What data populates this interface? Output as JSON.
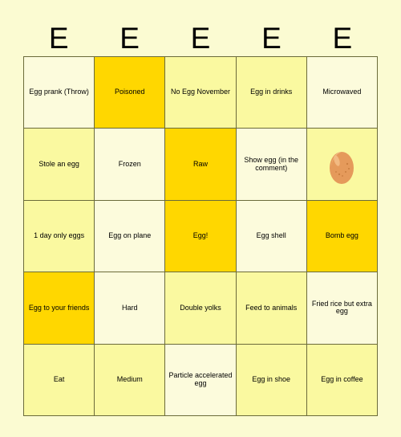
{
  "header": {
    "letters": [
      "E",
      "E",
      "E",
      "E",
      "E"
    ]
  },
  "colors": {
    "page_background": "#fbfbd2",
    "marked_gold": "#ffd700",
    "cell_yellow": "#faf9a0",
    "cell_cream": "#fcfbdc",
    "border": "#6b6b3a",
    "text": "#000000",
    "egg_body": "#e59a5b",
    "egg_highlight": "#f5c08a",
    "egg_speckle": "#c87c3e"
  },
  "grid": {
    "rows": 5,
    "columns": 5,
    "cells": [
      {
        "text": "Egg prank (Throw)",
        "bg": "cream",
        "size": "md"
      },
      {
        "text": "Poisoned",
        "bg": "gold",
        "size": "sm"
      },
      {
        "text": "No Egg November",
        "bg": "yellow",
        "size": "xs"
      },
      {
        "text": "Egg in drinks",
        "bg": "yellow",
        "size": "lg"
      },
      {
        "text": "Microwaved",
        "bg": "cream",
        "size": "xxs"
      },
      {
        "text": "Stole an egg",
        "bg": "yellow",
        "size": "md"
      },
      {
        "text": "Frozen",
        "bg": "cream",
        "size": "md"
      },
      {
        "text": "Raw",
        "bg": "gold",
        "size": "xl"
      },
      {
        "text": "Show egg (in the comment)",
        "bg": "cream",
        "size": "xs"
      },
      {
        "text": "",
        "bg": "yellow",
        "size": "md",
        "icon": "egg-emoji"
      },
      {
        "text": "1 day only eggs",
        "bg": "yellow",
        "size": "sm"
      },
      {
        "text": "Egg on plane",
        "bg": "cream",
        "size": "md"
      },
      {
        "text": "Egg!",
        "bg": "gold",
        "size": "xl"
      },
      {
        "text": "Egg shell",
        "bg": "cream",
        "size": "lg"
      },
      {
        "text": "Bomb egg",
        "bg": "gold",
        "size": "lg"
      },
      {
        "text": "Egg to your friends",
        "bg": "gold",
        "size": "sm"
      },
      {
        "text": "Hard",
        "bg": "cream",
        "size": "xl"
      },
      {
        "text": "Double yolks",
        "bg": "yellow",
        "size": "md"
      },
      {
        "text": "Feed to animals",
        "bg": "yellow",
        "size": "md"
      },
      {
        "text": "Fried rice but extra egg",
        "bg": "cream",
        "size": "xs"
      },
      {
        "text": "Eat",
        "bg": "yellow",
        "size": "xl"
      },
      {
        "text": "Medium",
        "bg": "yellow",
        "size": "sm"
      },
      {
        "text": "Particle accelerated egg",
        "bg": "cream",
        "size": "xs"
      },
      {
        "text": "Egg in shoe",
        "bg": "yellow",
        "size": "lg"
      },
      {
        "text": "Egg in coffee",
        "bg": "yellow",
        "size": "lg"
      }
    ]
  }
}
